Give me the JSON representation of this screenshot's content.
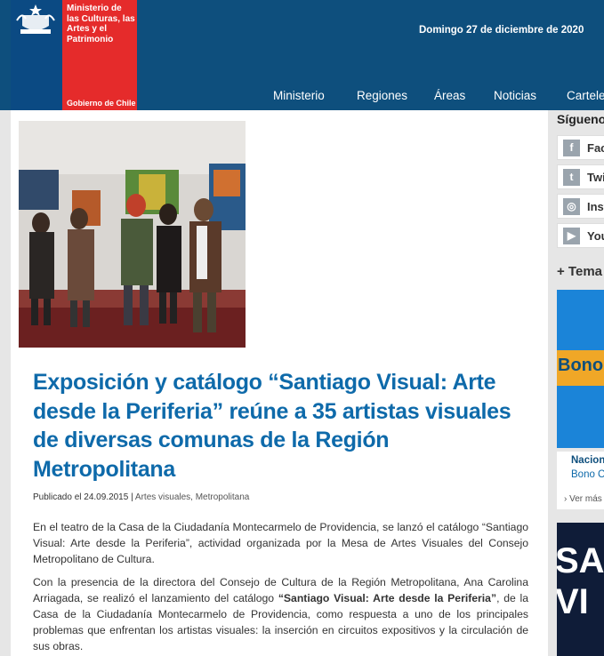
{
  "header": {
    "logo_text": "Ministerio de las Culturas, las Artes y el Patrimonio",
    "gobierno": "Gobierno de Chile",
    "date": "Domingo 27 de diciembre de 2020",
    "nav": [
      {
        "label": "Ministerio"
      },
      {
        "label": "Regiones"
      },
      {
        "label": "Áreas"
      },
      {
        "label": "Noticias"
      },
      {
        "label": "Cartele"
      }
    ]
  },
  "article": {
    "title": "Exposición y catálogo “Santiago Visual: Arte desde la Periferia” reúne a 35 artistas visuales de diversas comunas de la Región Metropolitana",
    "published": "Publicado el 24.09.2015",
    "tags": "Artes visuales, Metropolitana",
    "p1": "En el teatro de la Casa de la Ciudadanía Montecarmelo de Providencia, se lanzó el catálogo “Santiago Visual: Arte desde la Periferia”, actividad organizada por la Mesa de Artes Visuales del Consejo Metropolitano de Cultura.",
    "p2_a": "Con la presencia de la directora del Consejo de Cultura de la Región Metropolitana, Ana Carolina Arriagada, se realizó el lanzamiento del catálogo ",
    "p2_bold": "“Santiago Visual: Arte desde la Periferia”",
    "p2_b": ", de la Casa de la Ciudadanía Montecarmelo de Providencia, como respuesta a  uno de los principales problemas que enfrentan los artistas visuales: la inserción en circuitos expositivos y la circulación de sus obras."
  },
  "sidebar": {
    "follow_title": "Síguenos",
    "social": [
      {
        "icon": "facebook-icon",
        "glyph": "f",
        "label": "Fac"
      },
      {
        "icon": "twitter-icon",
        "glyph": "t",
        "label": "Twi"
      },
      {
        "icon": "instagram-icon",
        "glyph": "◎",
        "label": "Inst"
      },
      {
        "icon": "youtube-icon",
        "glyph": "▶",
        "label": "You"
      }
    ],
    "temas": "+ Tema",
    "bono_text": "Bono",
    "nacion": "Nacion",
    "bono_link": "Bono C",
    "ver_mas": "› Ver más",
    "banner_text": "SAN VI"
  },
  "colors": {
    "header_bg": "#0e4f7d",
    "logo_red": "#e52b2b",
    "title_blue": "#0e6aaa"
  }
}
